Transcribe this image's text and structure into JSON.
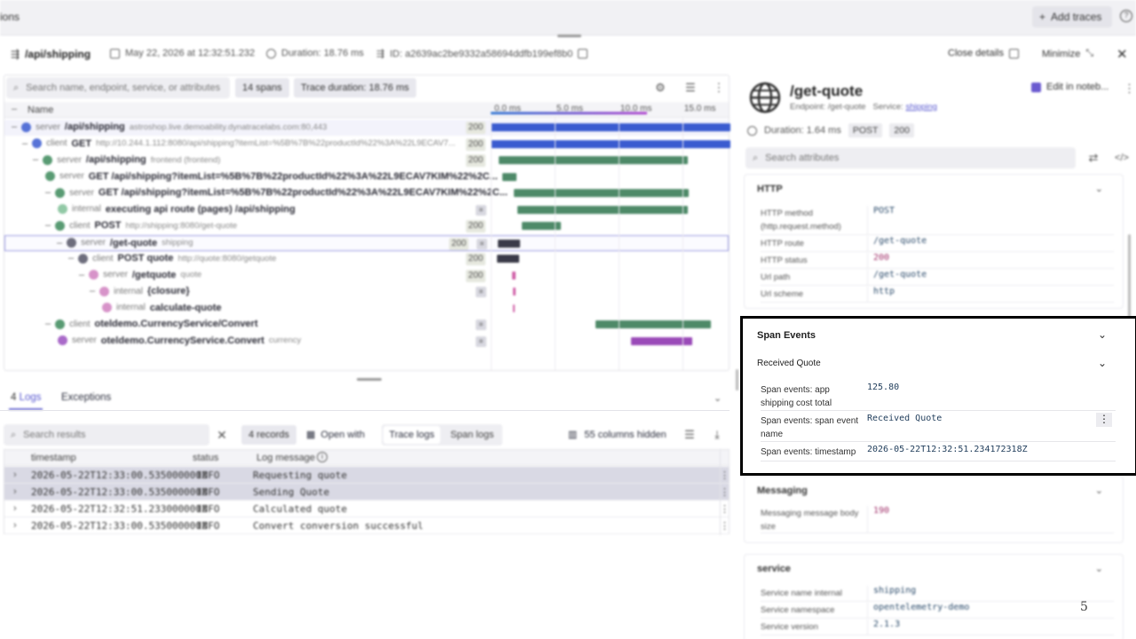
{
  "app": {
    "title_fragment": "ions",
    "add_traces": "Add traces"
  },
  "header": {
    "route": "/api/shipping",
    "date": "May 22, 2026 at 12:32:51.232",
    "duration": "Duration: 18.76 ms",
    "id": "ID: a2639ac2be9332a58694ddfb199ef8b0",
    "close_details": "Close details",
    "minimize": "Minimize"
  },
  "trace": {
    "search_placeholder": "Search name, endpoint, service, or attributes",
    "spans_chip": "14 spans",
    "duration_chip": "Trace duration: 18.76 ms",
    "col_name": "Name",
    "ticks": [
      "0.0 ms",
      "5.0 ms",
      "10.0 ms",
      "15.0 ms"
    ],
    "rows": [
      {
        "kind": "server",
        "name": "/api/shipping",
        "extra": "astroshop.live.demoability.dynatracelabs.com:80,443",
        "status": "200",
        "color": "#3a5bd0",
        "bar": {
          "start": 0.0,
          "end": 18.76,
          "color": "#3a5bd0"
        }
      },
      {
        "kind": "client",
        "name": "GET",
        "extra": "http://10.244.1.112:8080/api/shipping?itemList=%5B%7B%22productId%22%3A%22L9ECAV7...",
        "status": "200",
        "color": "#3a5bd0",
        "bar": {
          "start": 0.0,
          "end": 18.76,
          "color": "#3a5bd0"
        }
      },
      {
        "kind": "server",
        "name": "/api/shipping",
        "extra": "frontend (frontend)",
        "status": "200",
        "color": "#3c8a5a",
        "bar": {
          "start": 0.6,
          "end": 15.4,
          "color": "#4e8a68"
        }
      },
      {
        "kind": "server",
        "name": "GET /api/shipping?itemList=%5B%7B%22productId%22%3A%22L9ECAV7KIM%22%2C...",
        "extra": "",
        "status": "",
        "color": "#3c8a5a",
        "bar": {
          "start": 0.9,
          "end": 2.0,
          "color": "#4e8a68"
        }
      },
      {
        "kind": "server",
        "name": "GET /api/shipping?itemList=%5B%7B%22productId%22%3A%22L9ECAV7KIM%22%2C...",
        "extra": "",
        "status": "",
        "color": "#3c8a5a",
        "bar": {
          "start": 1.8,
          "end": 15.5,
          "color": "#4e8a68"
        }
      },
      {
        "kind": "internal",
        "name": "executing api route (pages) /api/shipping",
        "extra": "",
        "status": "",
        "color": "#7fbf96",
        "bar": {
          "start": 2.1,
          "end": 15.4,
          "color": "#4e8a68"
        }
      },
      {
        "kind": "client",
        "name": "POST",
        "extra": "http://shipping:8080/get-quote",
        "status": "200",
        "color": "#3c8a5a",
        "bar": {
          "start": 2.4,
          "end": 5.5,
          "color": "#4e8a68"
        }
      },
      {
        "kind": "server",
        "name": "/get-quote",
        "extra": "shipping",
        "status": "200",
        "color": "#555566",
        "bar": {
          "start": 0.5,
          "end": 2.2,
          "color": "#3a3a48"
        }
      },
      {
        "kind": "client",
        "name": "POST quote",
        "extra": "http://quote:8080/getquote",
        "status": "200",
        "color": "#555566",
        "bar": {
          "start": 0.5,
          "end": 2.2,
          "color": "#3a3a48"
        }
      },
      {
        "kind": "server",
        "name": "/getquote",
        "extra": "quote",
        "status": "200",
        "color": "#d080c0",
        "bar": {
          "start": 1.7,
          "end": 1.95,
          "color": "#d060a8"
        }
      },
      {
        "kind": "internal",
        "name": "{closure}",
        "extra": "",
        "status": "",
        "color": "#d080c0",
        "bar": {
          "start": 1.72,
          "end": 1.92,
          "color": "#d060a8"
        }
      },
      {
        "kind": "internal",
        "name": "calculate-quote",
        "extra": "",
        "status": "",
        "color": "#d080c0",
        "bar": {
          "start": 1.73,
          "end": 1.9,
          "color": "#d060a8"
        }
      },
      {
        "kind": "client",
        "name": "oteldemo.CurrencyService/Convert",
        "extra": "",
        "status": "",
        "color": "#3c8a5a",
        "bar": {
          "start": 8.2,
          "end": 17.2,
          "color": "#4e8a68"
        }
      },
      {
        "kind": "server",
        "name": "oteldemo.CurrencyService.Convert",
        "extra": "currency",
        "status": "",
        "color": "#9a50c0",
        "bar": {
          "start": 11.0,
          "end": 15.8,
          "color": "#9a4ab8"
        }
      }
    ]
  },
  "logs": {
    "tab_logs_count": "4",
    "tab_logs": "Logs",
    "tab_exceptions": "Exceptions",
    "search_placeholder": "Search results",
    "records_chip": "4 records",
    "open_with": "Open with",
    "trace_logs": "Trace logs",
    "span_logs": "Span logs",
    "hidden_cols": "55 columns hidden",
    "cols": [
      "timestamp",
      "status",
      "Log message"
    ],
    "rows": [
      {
        "ts": "2026-05-22T12:33:00.535000000Z",
        "status": "INFO",
        "msg": "Requesting quote"
      },
      {
        "ts": "2026-05-22T12:33:00.535000000Z",
        "status": "INFO",
        "msg": "Sending Quote"
      },
      {
        "ts": "2026-05-22T12:32:51.233000000Z",
        "status": "INFO",
        "msg": "Calculated quote"
      },
      {
        "ts": "2026-05-22T12:33:00.535000000Z",
        "status": "INFO",
        "msg": "Convert conversion successful"
      }
    ]
  },
  "detail": {
    "title": "/get-quote",
    "endpoint": "Endpoint: /get-quote",
    "service_label": "Service:",
    "service_link": "shipping",
    "edit_notebook": "Edit in noteb...",
    "duration": "Duration: 1.64 ms",
    "method_pill": "POST",
    "status_pill": "200",
    "search_attr_placeholder": "Search attributes",
    "http": {
      "title": "HTTP",
      "rows": [
        {
          "k": "HTTP method (http.request.method)",
          "v": "POST"
        },
        {
          "k": "HTTP route",
          "v": "/get-quote"
        },
        {
          "k": "HTTP status",
          "v": "200"
        },
        {
          "k": "Url path",
          "v": "/get-quote"
        },
        {
          "k": "Url scheme",
          "v": "http"
        }
      ]
    },
    "span_events": {
      "title": "Span Events",
      "event_name": "Received Quote",
      "rows": [
        {
          "k": "Span events: app shipping cost total",
          "v": "125.80"
        },
        {
          "k": "Span events: span event name",
          "v": "Received Quote"
        },
        {
          "k": "Span events: timestamp",
          "v": "2026-05-22T12:32:51.234172318Z"
        }
      ]
    },
    "messaging": {
      "title": "Messaging",
      "rows": [
        {
          "k": "Messaging message body size",
          "v": "190"
        }
      ]
    },
    "service": {
      "title": "service",
      "rows": [
        {
          "k": "Service name internal",
          "v": "shipping"
        },
        {
          "k": "Service namespace",
          "v": "opentelemetry-demo"
        },
        {
          "k": "Service version",
          "v": "2.1.3"
        }
      ]
    }
  },
  "page_number": "5"
}
